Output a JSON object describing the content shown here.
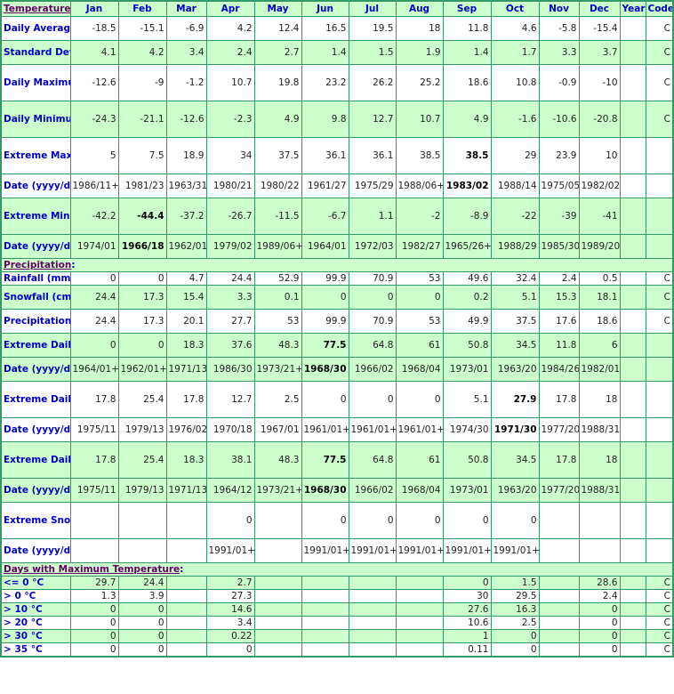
{
  "columns": [
    "Jan",
    "Feb",
    "Mar",
    "Apr",
    "May",
    "Jun",
    "Jul",
    "Aug",
    "Sep",
    "Oct",
    "Nov",
    "Dec",
    "Year",
    "Code"
  ],
  "sections": {
    "temperature": "Temperature",
    "precipitation": "Precipitation",
    "days_max_temp": "Days with Maximum Temperature",
    "colon": ":"
  },
  "rows": {
    "daily_average": {
      "label": "Daily Average (°C)",
      "values": [
        "-18.5",
        "-15.1",
        "-6.9",
        "4.2",
        "12.4",
        "16.5",
        "19.5",
        "18",
        "11.8",
        "4.6",
        "-5.8",
        "-15.4",
        "",
        "C"
      ]
    },
    "std_dev": {
      "label": "Standard Deviation",
      "values": [
        "4.1",
        "4.2",
        "3.4",
        "2.4",
        "2.7",
        "1.4",
        "1.5",
        "1.9",
        "1.4",
        "1.7",
        "3.3",
        "3.7",
        "",
        "C"
      ]
    },
    "daily_max": {
      "label": "Daily Maximum (°C)",
      "values": [
        "-12.6",
        "-9",
        "-1.2",
        "10.7",
        "19.8",
        "23.2",
        "26.2",
        "25.2",
        "18.6",
        "10.8",
        "-0.9",
        "-10",
        "",
        "C"
      ]
    },
    "daily_min": {
      "label": "Daily Minimum (°C)",
      "values": [
        "-24.3",
        "-21.1",
        "-12.6",
        "-2.3",
        "4.9",
        "9.8",
        "12.7",
        "10.7",
        "4.9",
        "-1.6",
        "-10.6",
        "-20.8",
        "",
        "C"
      ]
    },
    "extreme_max": {
      "label": "Extreme Maximum (°C)",
      "values": [
        "5",
        "7.5",
        "18.9",
        "34",
        "37.5",
        "36.1",
        "36.1",
        "38.5",
        "38.5",
        "29",
        "23.9",
        "10",
        "",
        ""
      ],
      "bold_index": 8
    },
    "extreme_max_date": {
      "label": "Date (yyyy/dd)",
      "values": [
        "1986/11+",
        "1981/23",
        "1963/31",
        "1980/21",
        "1980/22",
        "1961/27",
        "1975/29",
        "1988/06+",
        "1983/02",
        "1988/14",
        "1975/05",
        "1982/02",
        "",
        ""
      ],
      "bold_index": 8
    },
    "extreme_min": {
      "label": "Extreme Minimum (°C)",
      "values": [
        "-42.2",
        "-44.4",
        "-37.2",
        "-26.7",
        "-11.5",
        "-6.7",
        "1.1",
        "-2",
        "-8.9",
        "-22",
        "-39",
        "-41",
        "",
        ""
      ],
      "bold_index": 1
    },
    "extreme_min_date": {
      "label": "Date (yyyy/dd)",
      "values": [
        "1974/01",
        "1966/18",
        "1962/01",
        "1979/02",
        "1989/06+",
        "1964/01",
        "1972/03",
        "1982/27",
        "1965/26+",
        "1988/29",
        "1985/30",
        "1989/20",
        "",
        ""
      ],
      "bold_index": 1
    },
    "rainfall": {
      "label": "Rainfall (mm)",
      "values": [
        "0",
        "0",
        "4.7",
        "24.4",
        "52.9",
        "99.9",
        "70.9",
        "53",
        "49.6",
        "32.4",
        "2.4",
        "0.5",
        "",
        "C"
      ]
    },
    "snowfall": {
      "label": "Snowfall (cm)",
      "values": [
        "24.4",
        "17.3",
        "15.4",
        "3.3",
        "0.1",
        "0",
        "0",
        "0",
        "0.2",
        "5.1",
        "15.3",
        "18.1",
        "",
        "C"
      ]
    },
    "precipitation": {
      "label": "Precipitation (mm)",
      "values": [
        "24.4",
        "17.3",
        "20.1",
        "27.7",
        "53",
        "99.9",
        "70.9",
        "53",
        "49.9",
        "37.5",
        "17.6",
        "18.6",
        "",
        "C"
      ]
    },
    "ext_daily_rain": {
      "label": "Extreme Daily Rainfall (mm)",
      "values": [
        "0",
        "0",
        "18.3",
        "37.6",
        "48.3",
        "77.5",
        "64.8",
        "61",
        "50.8",
        "34.5",
        "11.8",
        "6",
        "",
        ""
      ],
      "bold_index": 5
    },
    "ext_daily_rain_date": {
      "label": "Date (yyyy/dd)",
      "values": [
        "1964/01+",
        "1962/01+",
        "1971/13",
        "1986/30",
        "1973/21+",
        "1968/30",
        "1966/02",
        "1968/04",
        "1973/01",
        "1963/20",
        "1984/26",
        "1982/01",
        "",
        ""
      ],
      "bold_index": 5
    },
    "ext_daily_snow": {
      "label": "Extreme Daily Snowfall (cm)",
      "values": [
        "17.8",
        "25.4",
        "17.8",
        "12.7",
        "2.5",
        "0",
        "0",
        "0",
        "5.1",
        "27.9",
        "17.8",
        "18",
        "",
        ""
      ],
      "bold_index": 9
    },
    "ext_daily_snow_date": {
      "label": "Date (yyyy/dd)",
      "values": [
        "1975/11",
        "1979/13",
        "1976/02",
        "1970/18",
        "1967/01",
        "1961/01+",
        "1961/01+",
        "1961/01+",
        "1974/30",
        "1971/30",
        "1977/20",
        "1988/31",
        "",
        ""
      ],
      "bold_index": 9
    },
    "ext_daily_precip": {
      "label": "Extreme Daily Precipitation (mm)",
      "values": [
        "17.8",
        "25.4",
        "18.3",
        "38.1",
        "48.3",
        "77.5",
        "64.8",
        "61",
        "50.8",
        "34.5",
        "17.8",
        "18",
        "",
        ""
      ],
      "bold_index": 5
    },
    "ext_daily_precip_date": {
      "label": "Date (yyyy/dd)",
      "values": [
        "1975/11",
        "1979/13",
        "1971/13",
        "1964/12",
        "1973/21+",
        "1968/30",
        "1966/02",
        "1968/04",
        "1973/01",
        "1963/20",
        "1977/20",
        "1988/31",
        "",
        ""
      ],
      "bold_index": 5
    },
    "ext_snow_depth": {
      "label": "Extreme Snow Depth (cm)",
      "values": [
        "",
        "",
        "",
        "0",
        "",
        "0",
        "0",
        "0",
        "0",
        "0",
        "",
        "",
        "",
        ""
      ]
    },
    "ext_snow_depth_date": {
      "label": "Date (yyyy/dd)",
      "values": [
        "",
        "",
        "",
        "1991/01+",
        "",
        "1991/01+",
        "1991/01+",
        "1991/01+",
        "1991/01+",
        "1991/01+",
        "",
        "",
        "",
        ""
      ]
    },
    "le_0": {
      "label": "<= 0 °C",
      "values": [
        "29.7",
        "24.4",
        "",
        "2.7",
        "",
        "",
        "",
        "",
        "0",
        "1.5",
        "",
        "28.6",
        "",
        "C"
      ]
    },
    "gt_0": {
      "label": "> 0 °C",
      "values": [
        "1.3",
        "3.9",
        "",
        "27.3",
        "",
        "",
        "",
        "",
        "30",
        "29.5",
        "",
        "2.4",
        "",
        "C"
      ]
    },
    "gt_10": {
      "label": "> 10 °C",
      "values": [
        "0",
        "0",
        "",
        "14.6",
        "",
        "",
        "",
        "",
        "27.6",
        "16.3",
        "",
        "0",
        "",
        "C"
      ]
    },
    "gt_20": {
      "label": "> 20 °C",
      "values": [
        "0",
        "0",
        "",
        "3.4",
        "",
        "",
        "",
        "",
        "10.6",
        "2.5",
        "",
        "0",
        "",
        "C"
      ]
    },
    "gt_30": {
      "label": "> 30 °C",
      "values": [
        "0",
        "0",
        "",
        "0.22",
        "",
        "",
        "",
        "",
        "1",
        "0",
        "",
        "0",
        "",
        "C"
      ]
    },
    "gt_35": {
      "label": "> 35 °C",
      "values": [
        "0",
        "0",
        "",
        "0",
        "",
        "",
        "",
        "",
        "0.11",
        "0",
        "",
        "0",
        "",
        "C"
      ]
    }
  },
  "colors": {
    "border": "#339966",
    "shade": "#ccffcc",
    "label_text": "#0000cc",
    "section_link": "#660066"
  }
}
